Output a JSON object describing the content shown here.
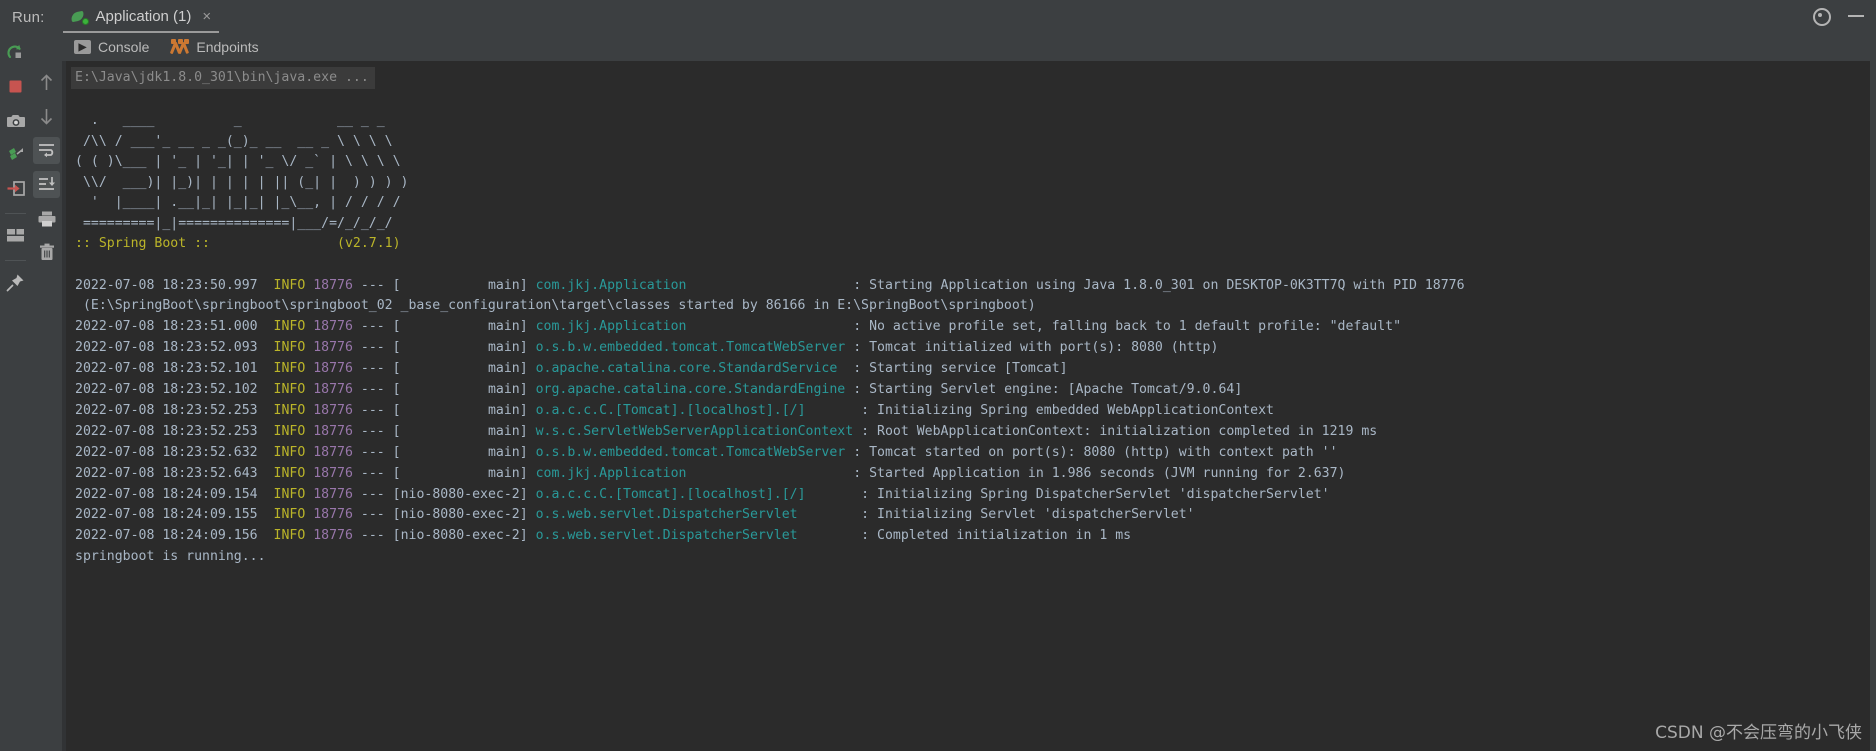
{
  "window": {
    "run_label": "Run:",
    "tab_title": "Application (1)",
    "tab_close": "×",
    "settings_icon": "gear-icon",
    "minimize_icon": "minimize-icon"
  },
  "console_tabs": [
    {
      "label": "Console",
      "icon": "console-icon",
      "glyph": "▶",
      "active": true
    },
    {
      "label": "Endpoints",
      "icon": "endpoints-icon",
      "active": false
    }
  ],
  "toolbar_left": [
    {
      "name": "rerun-button",
      "title": "Rerun"
    },
    {
      "name": "stop-button",
      "title": "Stop"
    },
    {
      "name": "snapshot-button",
      "title": "Snapshot"
    },
    {
      "name": "thread-dump-button",
      "title": "Thread Dump"
    },
    {
      "name": "export-button",
      "title": "Export"
    },
    {
      "name": "layout-button",
      "title": "Layout Settings"
    },
    {
      "name": "pin-button",
      "title": "Pin Tab"
    }
  ],
  "toolbar_second": [
    {
      "name": "scroll-up-button",
      "title": "Up the Stack Trace"
    },
    {
      "name": "scroll-down-button",
      "title": "Down the Stack Trace"
    },
    {
      "name": "soft-wrap-button",
      "title": "Soft-Wrap",
      "active": true
    },
    {
      "name": "scroll-to-end-button",
      "title": "Scroll to End",
      "active": true
    },
    {
      "name": "print-button",
      "title": "Print"
    },
    {
      "name": "clear-all-button",
      "title": "Clear All"
    }
  ],
  "console": {
    "command_line": "E:\\Java\\jdk1.8.0_301\\bin\\java.exe ...",
    "banner_lines": [
      "  .   ____          _            __ _ _",
      " /\\\\ / ___'_ __ _ _(_)_ __  __ _ \\ \\ \\ \\",
      "( ( )\\___ | '_ | '_| | '_ \\/ _` | \\ \\ \\ \\",
      " \\\\/  ___)| |_)| | | | | || (_| |  ) ) ) )",
      "  '  |____| .__|_| |_|_| |_\\__, | / / / /",
      " =========|_|==============|___/=/_/_/_/"
    ],
    "banner_version_line": ":: Spring Boot ::                (v2.7.1)",
    "log_lines": [
      {
        "ts": "2022-07-08 18:23:50.997",
        "level": "INFO",
        "pid": "18776",
        "thread": "[           main]",
        "logger": "com.jkj.Application",
        "logger_pad": "                    ",
        "msg": ": Starting Application using Java 1.8.0_301 on DESKTOP-0K3TT7Q with PID 18776"
      },
      {
        "continuation": " (E:\\SpringBoot\\springboot\\springboot_02 _base_configuration\\target\\classes started by 86166 in E:\\SpringBoot\\springboot)"
      },
      {
        "ts": "2022-07-08 18:23:51.000",
        "level": "INFO",
        "pid": "18776",
        "thread": "[           main]",
        "logger": "com.jkj.Application",
        "logger_pad": "                    ",
        "msg": ": No active profile set, falling back to 1 default profile: \"default\""
      },
      {
        "ts": "2022-07-08 18:23:52.093",
        "level": "INFO",
        "pid": "18776",
        "thread": "[           main]",
        "logger": "o.s.b.w.embedded.tomcat.TomcatWebServer",
        "logger_pad": "",
        "msg": ": Tomcat initialized with port(s): 8080 (http)"
      },
      {
        "ts": "2022-07-08 18:23:52.101",
        "level": "INFO",
        "pid": "18776",
        "thread": "[           main]",
        "logger": "o.apache.catalina.core.StandardService",
        "logger_pad": " ",
        "msg": ": Starting service [Tomcat]"
      },
      {
        "ts": "2022-07-08 18:23:52.102",
        "level": "INFO",
        "pid": "18776",
        "thread": "[           main]",
        "logger": "org.apache.catalina.core.StandardEngine",
        "logger_pad": "",
        "msg": ": Starting Servlet engine: [Apache Tomcat/9.0.64]"
      },
      {
        "ts": "2022-07-08 18:23:52.253",
        "level": "INFO",
        "pid": "18776",
        "thread": "[           main]",
        "logger": "o.a.c.c.C.[Tomcat].[localhost].[/]",
        "logger_pad": "      ",
        "msg": ": Initializing Spring embedded WebApplicationContext"
      },
      {
        "ts": "2022-07-08 18:23:52.253",
        "level": "INFO",
        "pid": "18776",
        "thread": "[           main]",
        "logger": "w.s.c.ServletWebServerApplicationContext",
        "logger_pad": "",
        "msg": ": Root WebApplicationContext: initialization completed in 1219 ms"
      },
      {
        "ts": "2022-07-08 18:23:52.632",
        "level": "INFO",
        "pid": "18776",
        "thread": "[           main]",
        "logger": "o.s.b.w.embedded.tomcat.TomcatWebServer",
        "logger_pad": "",
        "msg": ": Tomcat started on port(s): 8080 (http) with context path ''"
      },
      {
        "ts": "2022-07-08 18:23:52.643",
        "level": "INFO",
        "pid": "18776",
        "thread": "[           main]",
        "logger": "com.jkj.Application",
        "logger_pad": "                    ",
        "msg": ": Started Application in 1.986 seconds (JVM running for 2.637)"
      },
      {
        "ts": "2022-07-08 18:24:09.154",
        "level": "INFO",
        "pid": "18776",
        "thread": "[nio-8080-exec-2]",
        "logger": "o.a.c.c.C.[Tomcat].[localhost].[/]",
        "logger_pad": "      ",
        "msg": ": Initializing Spring DispatcherServlet 'dispatcherServlet'"
      },
      {
        "ts": "2022-07-08 18:24:09.155",
        "level": "INFO",
        "pid": "18776",
        "thread": "[nio-8080-exec-2]",
        "logger": "o.s.web.servlet.DispatcherServlet",
        "logger_pad": "       ",
        "msg": ": Initializing Servlet 'dispatcherServlet'"
      },
      {
        "ts": "2022-07-08 18:24:09.156",
        "level": "INFO",
        "pid": "18776",
        "thread": "[nio-8080-exec-2]",
        "logger": "o.s.web.servlet.DispatcherServlet",
        "logger_pad": "       ",
        "msg": ": Completed initialization in 1 ms"
      },
      {
        "plain": "springboot is running..."
      }
    ]
  },
  "watermark": "CSDN @不会压弯的小飞侠",
  "colors": {
    "console_bg": "#2b2b2b",
    "chrome_bg": "#3c3f41",
    "text": "#a9b7c6",
    "level": "#bbb529",
    "pid": "#9876aa",
    "logger": "#299999",
    "accent_green": "#499c54",
    "accent_orange": "#cc7832",
    "stop_red": "#c75450"
  }
}
